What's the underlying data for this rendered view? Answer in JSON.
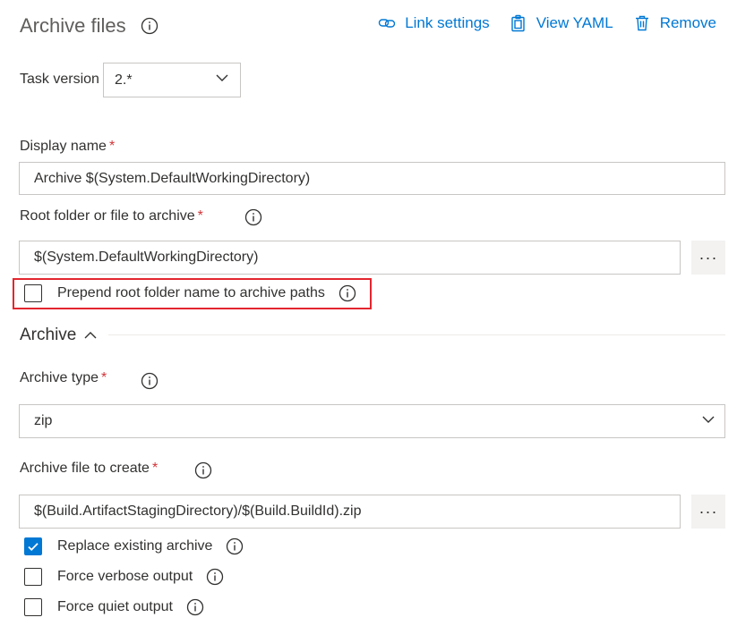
{
  "header": {
    "title": "Archive files",
    "actions": [
      {
        "label": "Link settings",
        "icon": "link-icon"
      },
      {
        "label": "View YAML",
        "icon": "clipboard-icon"
      },
      {
        "label": "Remove",
        "icon": "trash-icon"
      }
    ]
  },
  "task_version": {
    "label": "Task version",
    "value": "2.*"
  },
  "display_name": {
    "label": "Display name",
    "required": "*",
    "value": "Archive $(System.DefaultWorkingDirectory)"
  },
  "root_folder": {
    "label": "Root folder or file to archive",
    "required": "*",
    "value": "$(System.DefaultWorkingDirectory)",
    "more": "···"
  },
  "prepend": {
    "label": "Prepend root folder name to archive paths",
    "checked": false
  },
  "archive_section": {
    "title": "Archive"
  },
  "archive_type": {
    "label": "Archive type",
    "required": "*",
    "value": "zip"
  },
  "archive_file": {
    "label": "Archive file to create",
    "required": "*",
    "value": "$(Build.ArtifactStagingDirectory)/$(Build.BuildId).zip",
    "more": "···"
  },
  "options": [
    {
      "label": "Replace existing archive",
      "checked": true
    },
    {
      "label": "Force verbose output",
      "checked": false
    },
    {
      "label": "Force quiet output",
      "checked": false
    }
  ],
  "colors": {
    "accent": "#0078d4",
    "required": "#d13438",
    "highlight": "#e3262f"
  }
}
